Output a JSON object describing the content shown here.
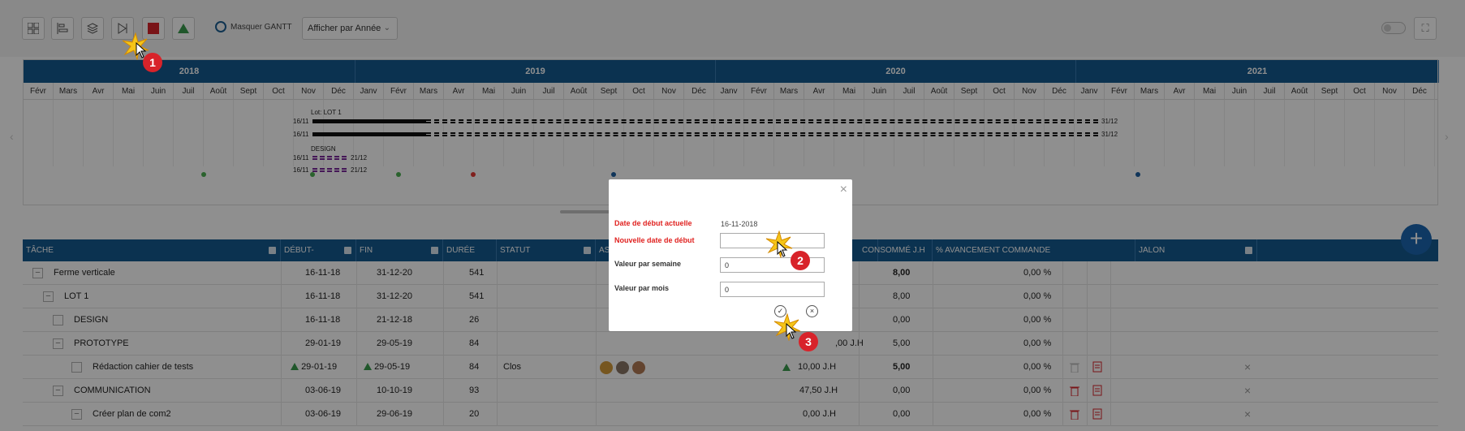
{
  "toolbar": {
    "masquer_label": "Masquer GANTT",
    "view_select": "Afficher par Année"
  },
  "gantt": {
    "years": [
      "2018",
      "2019",
      "2020",
      "2021"
    ],
    "months": [
      "Févr",
      "Mars",
      "Avr",
      "Mai",
      "Juin",
      "Juil",
      "Août",
      "Sept",
      "Oct",
      "Nov",
      "Déc",
      "Janv",
      "Févr",
      "Mars",
      "Avr",
      "Mai",
      "Juin",
      "Juil",
      "Août",
      "Sept",
      "Oct",
      "Nov",
      "Déc",
      "Janv",
      "Févr",
      "Mars",
      "Avr",
      "Mai",
      "Juin",
      "Juil",
      "Août",
      "Sept",
      "Oct",
      "Nov",
      "Déc",
      "Janv",
      "Févr",
      "Mars",
      "Avr",
      "Mai",
      "Juin",
      "Juil",
      "Août",
      "Sept",
      "Oct",
      "Nov",
      "Déc"
    ],
    "group_lot": "Lot: LOT 1",
    "group_design": "DESIGN",
    "bar1_start": "16/11",
    "bar1_end": "31/12",
    "bar2_start": "16/11",
    "bar2_end": "31/12",
    "bar3_start": "16/11",
    "bar3_end": "21/12",
    "bar4_start": "16/11",
    "bar4_end": "21/12"
  },
  "table": {
    "headers": {
      "tache": "TÂCHE",
      "debut": "DÉBUT-",
      "fin": "FIN",
      "duree": "DURÉE",
      "statut": "STATUT",
      "assign": "ASS",
      "consomme": "CONSOMMÉ J.H",
      "avancement": "% AVANCEMENT COMMANDE",
      "jalon": "JALON"
    },
    "rows": [
      {
        "name": "Ferme verticale",
        "debut": "16-11-18",
        "fin": "31-12-20",
        "duree": "541",
        "statut": "",
        "charge": "",
        "consomme": "8,00",
        "pct": "0,00 %"
      },
      {
        "name": "LOT 1",
        "debut": "16-11-18",
        "fin": "31-12-20",
        "duree": "541",
        "statut": "",
        "charge": "",
        "consomme": "8,00",
        "pct": "0,00 %"
      },
      {
        "name": "DESIGN",
        "debut": "16-11-18",
        "fin": "21-12-18",
        "duree": "26",
        "statut": "",
        "charge": "",
        "consomme": "0,00",
        "pct": "0,00 %"
      },
      {
        "name": "PROTOTYPE",
        "debut": "29-01-19",
        "fin": "29-05-19",
        "duree": "84",
        "statut": "",
        "charge": ",00 J.H",
        "consomme": "5,00",
        "pct": "0,00 %"
      },
      {
        "name": "Rédaction cahier de tests",
        "debut": "29-01-19",
        "fin": "29-05-19",
        "duree": "84",
        "statut": "Clos",
        "charge": "10,00 J.H",
        "consomme": "5,00",
        "pct": "0,00 %"
      },
      {
        "name": "COMMUNICATION",
        "debut": "03-06-19",
        "fin": "10-10-19",
        "duree": "93",
        "statut": "",
        "charge": "47,50 J.H",
        "consomme": "0,00",
        "pct": "0,00 %"
      },
      {
        "name": "Créer plan de com2",
        "debut": "03-06-19",
        "fin": "29-06-19",
        "duree": "20",
        "statut": "",
        "charge": "0,00 J.H",
        "consomme": "0,00",
        "pct": "0,00 %"
      }
    ]
  },
  "modal": {
    "label_current": "Date de début actuelle",
    "value_current": "16-11-2018",
    "label_new": "Nouvelle date de début",
    "value_new": "",
    "label_week": "Valeur par semaine",
    "value_week": "0",
    "label_month": "Valeur par mois",
    "value_month": "0"
  },
  "callouts": [
    "1",
    "2",
    "3"
  ],
  "colors": {
    "header_blue": "#155a8f",
    "modal_label_red": "#e0211f",
    "badge_red": "#d8232a",
    "triangle_green": "#3a9b4e",
    "bar_purple": "#7b2a9c",
    "fab_blue": "#1b66b0"
  },
  "icons": [
    "grid-icon",
    "align-left-icon",
    "layers-icon",
    "play-next-icon",
    "stop-icon",
    "triangle-icon",
    "expand-icon",
    "close-icon",
    "check-icon",
    "cancel-icon",
    "plus-icon",
    "trash-icon",
    "document-icon",
    "x-icon"
  ]
}
